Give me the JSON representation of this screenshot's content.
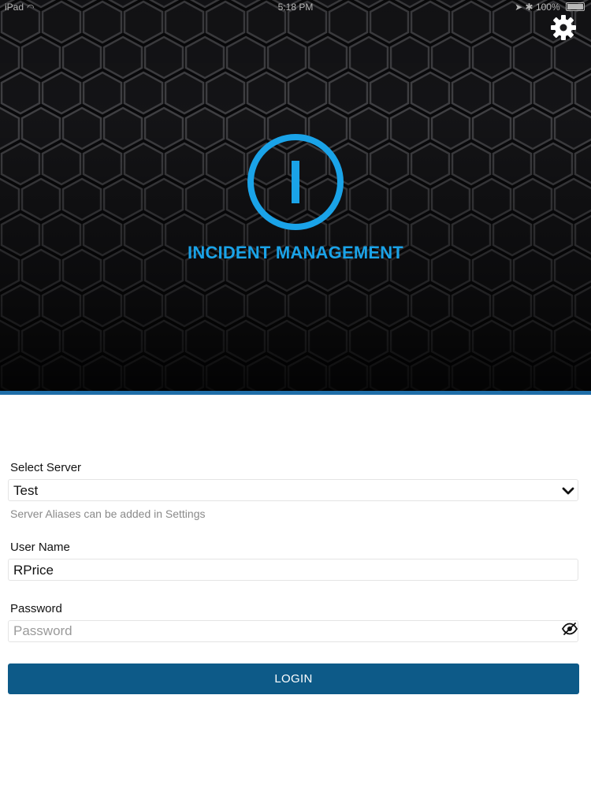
{
  "status_bar": {
    "device": "iPad",
    "time": "5:18 PM",
    "battery": "100%"
  },
  "header": {
    "app_title": "INCIDENT MANAGEMENT",
    "logo_icon": "power-i-logo-icon",
    "settings_icon": "gear-icon",
    "accent_color": "#1aa3e8"
  },
  "form": {
    "server": {
      "label": "Select Server",
      "selected": "Test",
      "hint": "Server Aliases can be added in Settings"
    },
    "username": {
      "label": "User Name",
      "value": "RPrice"
    },
    "password": {
      "label": "Password",
      "placeholder": "Password",
      "value": ""
    },
    "login_label": "LOGIN",
    "login_color": "#0d5a88"
  }
}
